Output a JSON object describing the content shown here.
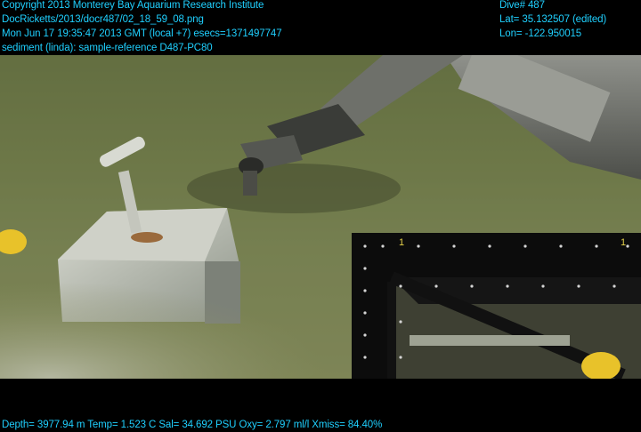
{
  "overlay": {
    "copyright": "Copyright 2013 Monterey Bay Aquarium Research Institute",
    "file_path": "DocRicketts/2013/docr487/02_18_59_08.png",
    "datetime": "Mon Jun 17 19:35:47 2013 GMT (local +7)  esecs=1371497747",
    "annotation": "sediment (linda): sample-reference D487-PC80",
    "dive": "Dive# 487",
    "lat": "Lat= 35.132507 (edited)",
    "lon": "Lon= -122.950015",
    "telemetry": "Depth= 3977.94 m  Temp= 1.523 C  Sal= 34.692 PSU  Oxy= 2.797 ml/l  Xmiss= 84.40%"
  },
  "colors": {
    "overlay_text": "#1fd0ff",
    "seafloor": "#7d8658",
    "frame_black": "#0a0a0a"
  }
}
